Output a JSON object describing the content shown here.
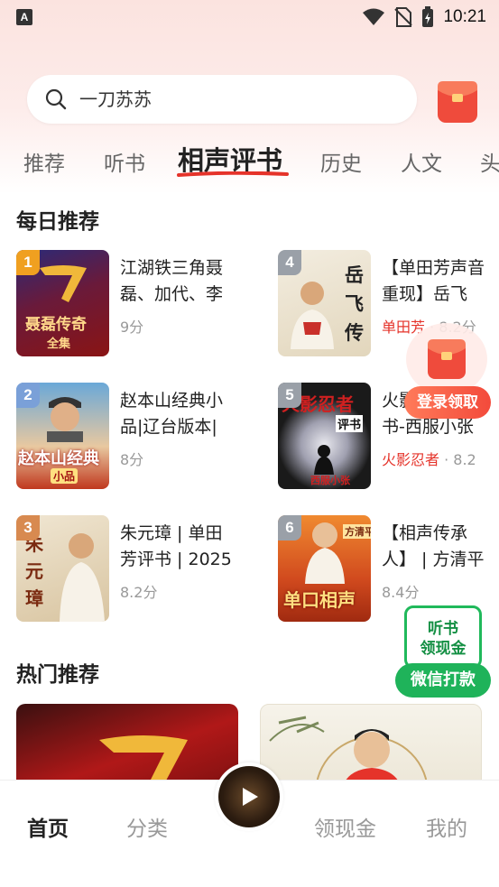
{
  "status_bar": {
    "time": "10:21",
    "app_badge": "A"
  },
  "search": {
    "query": "一刀苏苏"
  },
  "tabs": [
    {
      "label": "推荐"
    },
    {
      "label": "听书"
    },
    {
      "label": "相声评书",
      "active": true
    },
    {
      "label": "历史"
    },
    {
      "label": "人文"
    },
    {
      "label": "头"
    }
  ],
  "daily": {
    "title": "每日推荐",
    "items": [
      {
        "rank": "1",
        "title": "江湖铁三角聂磊、加代、李",
        "meta": "9分",
        "cover_text": [
          "聂磊传奇",
          "全集"
        ],
        "rank_color": "#f0a020",
        "cover_color": "#7a1010"
      },
      {
        "rank": "4",
        "title": "【单田芳声音重现】岳飞",
        "author": "单田芳",
        "meta": "8.2分",
        "cover_text": [
          "岳",
          "飞",
          "传"
        ],
        "rank_color": "#9aa0a8",
        "cover_color": "#e9e2d2"
      },
      {
        "rank": "2",
        "title": "赵本山经典小品|辽台版本|",
        "meta": "8分",
        "cover_text": [
          "赵本山经典",
          "小品"
        ],
        "rank_color": "#7aa0d8",
        "cover_color": "#c0381e"
      },
      {
        "rank": "5",
        "title": "火影忍者评书-西服小张",
        "author": "火影忍者",
        "meta": "8.2",
        "cover_text": [
          "火影忍者",
          "评书",
          "西服小张"
        ],
        "rank_color": "#9aa0a8",
        "cover_color": "#1a1a1a"
      },
      {
        "rank": "3",
        "title": "朱元璋 | 单田芳评书 | 2025",
        "meta": "8.2分",
        "cover_text": [
          "朱",
          "元",
          "璋"
        ],
        "rank_color": "#d88a50",
        "cover_color": "#e8dcc4"
      },
      {
        "rank": "6",
        "title": "【相声传承人】 | 方清平",
        "meta": "8.4分",
        "cover_text": [
          "单口相声",
          "方清平"
        ],
        "rank_color": "#9aa0a8",
        "cover_color": "#d14a1e"
      }
    ]
  },
  "floating": {
    "login_label": "登录领取",
    "wechat_lines": [
      "听书",
      "领现金"
    ],
    "wechat_button": "微信打款"
  },
  "hot": {
    "title": "热门推荐"
  },
  "bottom_nav": [
    {
      "label": "首页",
      "active": true
    },
    {
      "label": "分类"
    },
    {
      "label": "领现金"
    },
    {
      "label": "我的"
    }
  ],
  "colors": {
    "accent_red": "#e5332a",
    "wechat_green": "#1fb35a"
  }
}
